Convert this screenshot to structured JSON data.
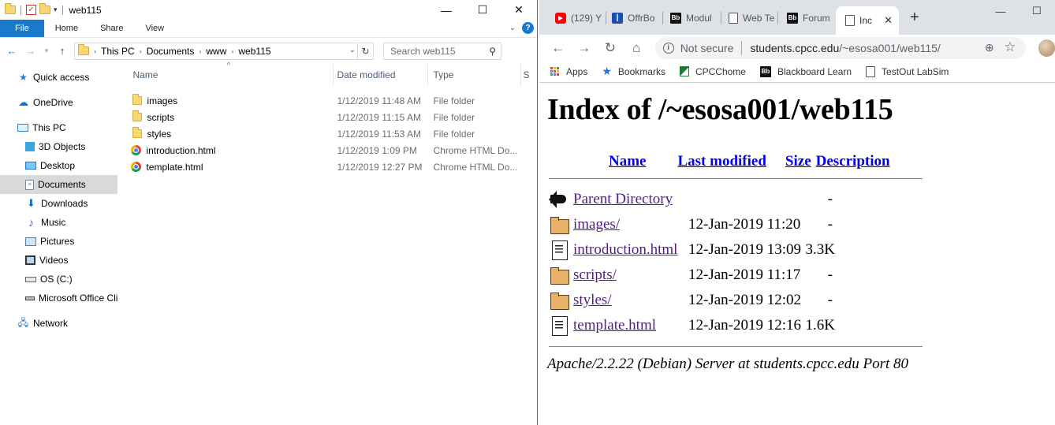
{
  "explorer": {
    "window_title": "web115",
    "win_controls": {
      "minimize": "—",
      "maximize": "☐",
      "close": "✕"
    },
    "ribbon": {
      "tabs": [
        {
          "label": "File"
        },
        {
          "label": "Home"
        },
        {
          "label": "Share"
        },
        {
          "label": "View"
        }
      ],
      "help": "?"
    },
    "address": {
      "crumbs": [
        {
          "label": "This PC"
        },
        {
          "label": "Documents"
        },
        {
          "label": "www"
        },
        {
          "label": "web115"
        }
      ]
    },
    "search": {
      "placeholder": "Search web115"
    },
    "nav": [
      {
        "label": "Quick access",
        "icon": "star-icon"
      },
      {
        "label": "OneDrive",
        "icon": "cloud-icon"
      },
      {
        "label": "This PC",
        "icon": "computer-icon"
      },
      {
        "label": "3D Objects",
        "icon": "cube-icon"
      },
      {
        "label": "Desktop",
        "icon": "desktop-icon"
      },
      {
        "label": "Documents",
        "icon": "documents-icon",
        "selected": true
      },
      {
        "label": "Downloads",
        "icon": "download-icon"
      },
      {
        "label": "Music",
        "icon": "music-icon"
      },
      {
        "label": "Pictures",
        "icon": "pictures-icon"
      },
      {
        "label": "Videos",
        "icon": "videos-icon"
      },
      {
        "label": "OS (C:)",
        "icon": "drive-icon"
      },
      {
        "label": "Microsoft Office Cli",
        "icon": "network-drive-icon"
      },
      {
        "label": "Network",
        "icon": "network-icon"
      }
    ],
    "columns": {
      "name": "Name",
      "date": "Date modified",
      "type": "Type",
      "size": "S"
    },
    "files": [
      {
        "name": "images",
        "date": "1/12/2019 11:48 AM",
        "type": "File folder",
        "icon": "folder-icon"
      },
      {
        "name": "scripts",
        "date": "1/12/2019 11:15 AM",
        "type": "File folder",
        "icon": "folder-icon"
      },
      {
        "name": "styles",
        "date": "1/12/2019 11:53 AM",
        "type": "File folder",
        "icon": "folder-icon"
      },
      {
        "name": "introduction.html",
        "date": "1/12/2019 1:09 PM",
        "type": "Chrome HTML Do...",
        "icon": "chrome-icon"
      },
      {
        "name": "template.html",
        "date": "1/12/2019 12:27 PM",
        "type": "Chrome HTML Do...",
        "icon": "chrome-icon"
      }
    ]
  },
  "browser": {
    "tabs": [
      {
        "title": "(129) Y",
        "favicon": "youtube-icon"
      },
      {
        "title": "OffrBo",
        "favicon": "offerbox-icon"
      },
      {
        "title": "Modul",
        "favicon": "blackboard-icon"
      },
      {
        "title": "Web Te",
        "favicon": "page-icon"
      },
      {
        "title": "Forum",
        "favicon": "blackboard-icon"
      },
      {
        "title": "Inc",
        "favicon": "page-icon",
        "active": true
      }
    ],
    "new_tab": "+",
    "win_controls": {
      "minimize": "—",
      "maximize": "☐"
    },
    "omnibox": {
      "security": "Not secure",
      "url_host": "students.cpcc.edu",
      "url_path": "/~esosa001/web115/"
    },
    "bookmarks": [
      {
        "label": "Apps",
        "icon": "apps-icon"
      },
      {
        "label": "Bookmarks",
        "icon": "star-icon"
      },
      {
        "label": "CPCChome",
        "icon": "cpcc-icon"
      },
      {
        "label": "Blackboard Learn",
        "icon": "blackboard-icon"
      },
      {
        "label": "TestOut LabSim",
        "icon": "page-icon"
      }
    ],
    "page": {
      "heading": "Index of /~esosa001/web115",
      "columns": {
        "name": "Name",
        "modified": "Last modified",
        "size": "Size",
        "description": "Description"
      },
      "entries": [
        {
          "name": "Parent Directory",
          "modified": "",
          "size": "-",
          "icon": "back-icon"
        },
        {
          "name": "images/",
          "modified": "12-Jan-2019 11:20",
          "size": "-",
          "icon": "folder-icon"
        },
        {
          "name": "introduction.html",
          "modified": "12-Jan-2019 13:09",
          "size": "3.3K",
          "icon": "file-icon"
        },
        {
          "name": "scripts/",
          "modified": "12-Jan-2019 11:17",
          "size": "-",
          "icon": "folder-icon"
        },
        {
          "name": "styles/",
          "modified": "12-Jan-2019 12:02",
          "size": "-",
          "icon": "folder-icon"
        },
        {
          "name": "template.html",
          "modified": "12-Jan-2019 12:16",
          "size": "1.6K",
          "icon": "file-icon"
        }
      ],
      "footer": "Apache/2.2.22 (Debian) Server at students.cpcc.edu Port 80"
    }
  }
}
